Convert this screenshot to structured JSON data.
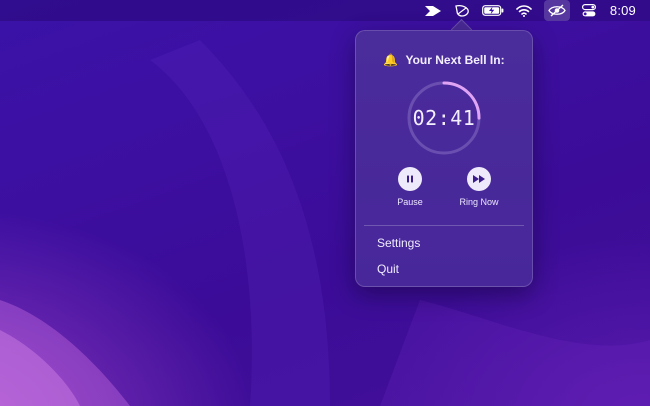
{
  "menubar": {
    "items": [
      {
        "icon": "arrow-app-icon"
      },
      {
        "icon": "bell-leaf-icon"
      },
      {
        "icon": "battery-charging-icon"
      },
      {
        "icon": "wifi-icon"
      },
      {
        "icon": "eye-slash-icon"
      },
      {
        "icon": "control-center-icon"
      }
    ],
    "clock": "8:09"
  },
  "popover": {
    "bell_emoji": "🔔",
    "title": "Your Next Bell In:",
    "countdown": "02:41",
    "progress": 0.25,
    "pause_label": "Pause",
    "ring_now_label": "Ring Now",
    "menu": {
      "settings": "Settings",
      "quit": "Quit"
    }
  },
  "colors": {
    "ring_track": "#6a4fb0",
    "ring_progress": "#e0a4f5",
    "button_bg": "#efeafb",
    "button_icon": "#3a1c8a"
  }
}
